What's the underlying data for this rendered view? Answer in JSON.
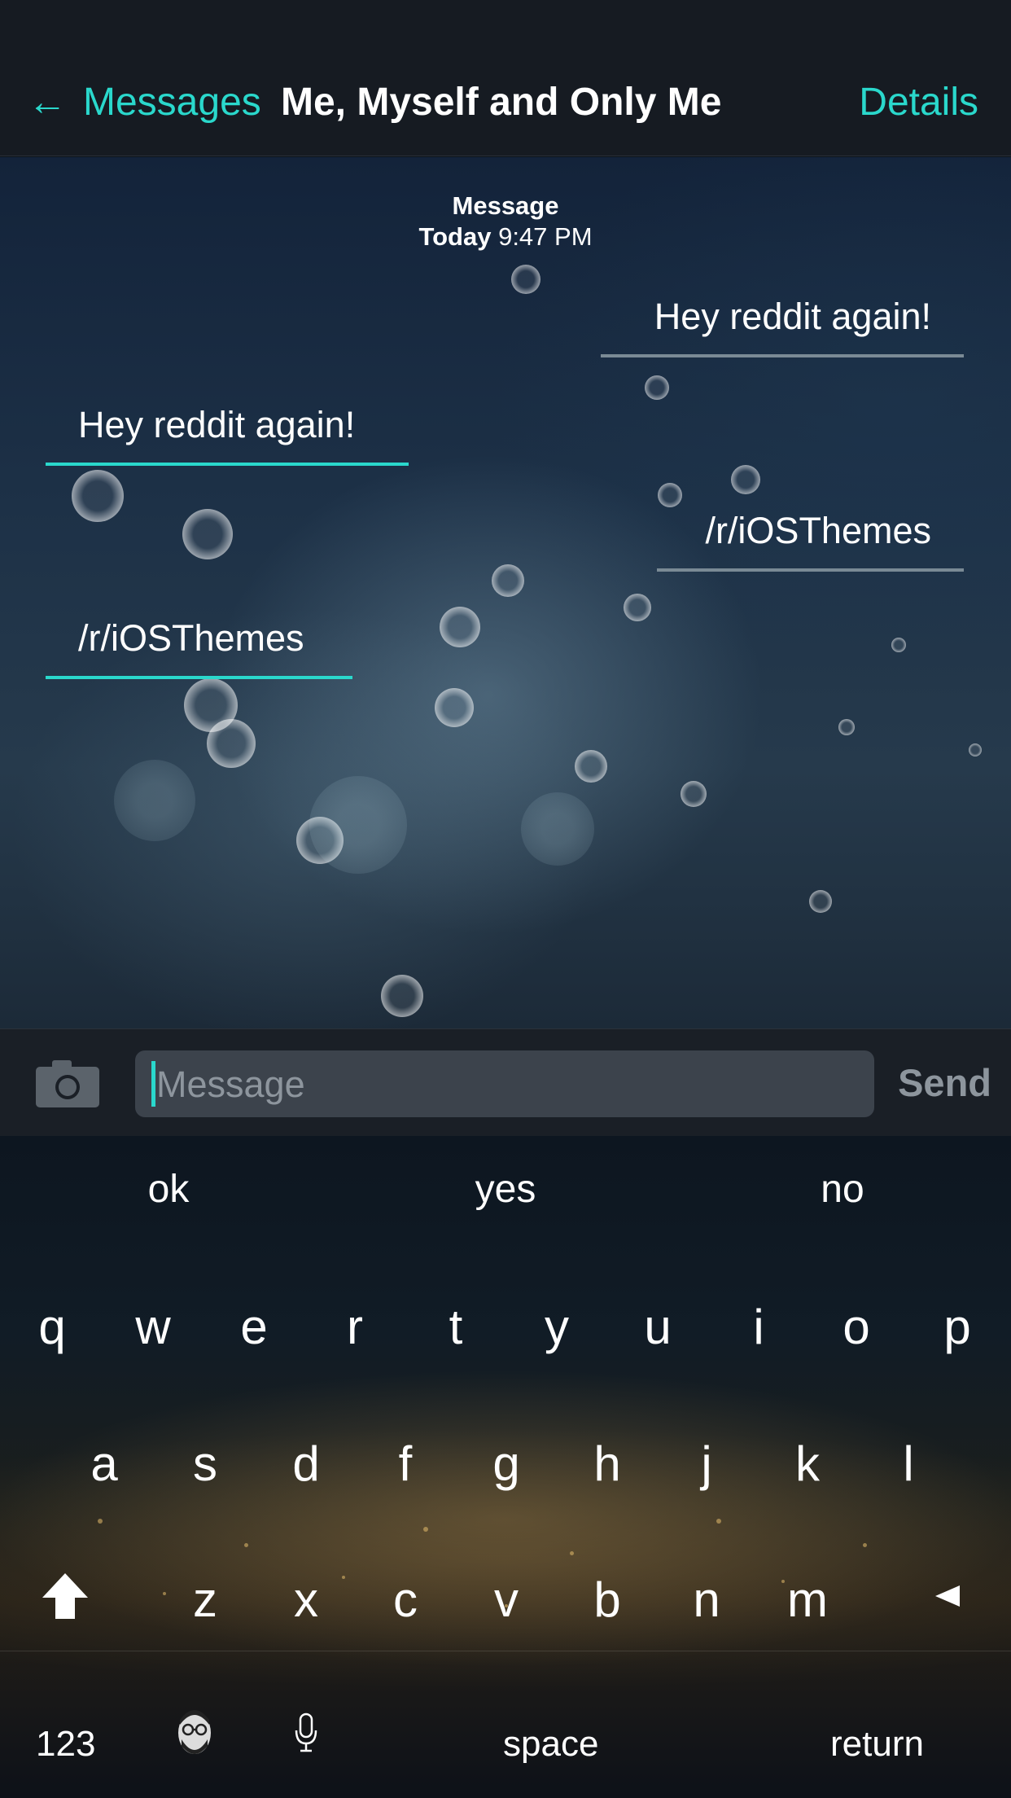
{
  "nav": {
    "back_label": "Messages",
    "title": "Me, Myself and Only Me",
    "details_label": "Details"
  },
  "conversation": {
    "stamp_label": "Message",
    "stamp_day": "Today",
    "stamp_time": "9:47 PM",
    "messages": [
      {
        "direction": "outgoing",
        "text": "Hey reddit again!"
      },
      {
        "direction": "incoming",
        "text": "Hey reddit again!"
      },
      {
        "direction": "outgoing",
        "text": "/r/iOSThemes"
      },
      {
        "direction": "incoming",
        "text": "/r/iOSThemes"
      }
    ]
  },
  "composer": {
    "placeholder": "Message",
    "send_label": "Send",
    "camera_icon": "camera-icon"
  },
  "keyboard": {
    "suggestions": [
      "ok",
      "yes",
      "no"
    ],
    "row1": [
      "q",
      "w",
      "e",
      "r",
      "t",
      "y",
      "u",
      "i",
      "o",
      "p"
    ],
    "row2": [
      "a",
      "s",
      "d",
      "f",
      "g",
      "h",
      "j",
      "k",
      "l"
    ],
    "row3": [
      "z",
      "x",
      "c",
      "v",
      "b",
      "n",
      "m"
    ],
    "numbers_label": "123",
    "space_label": "space",
    "return_label": "return",
    "icons": [
      "shift-icon",
      "delete-icon",
      "emoji-face-icon",
      "microphone-icon"
    ]
  },
  "colors": {
    "accent": "#2ad8cc",
    "navbar_bg": "#161b22",
    "muted_text": "#8d959d"
  }
}
